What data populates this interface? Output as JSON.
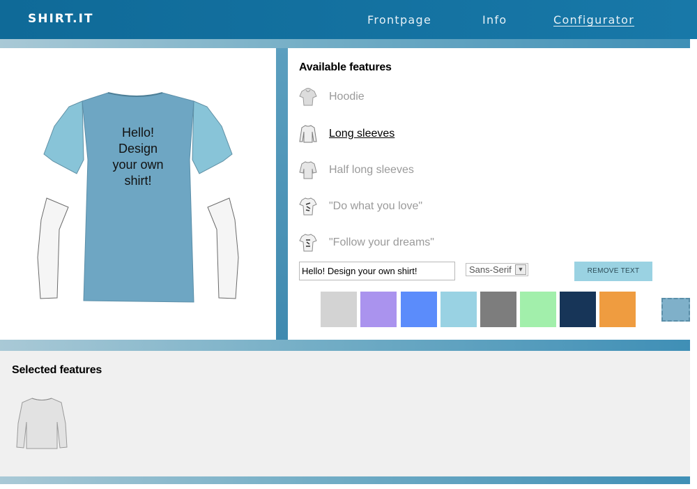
{
  "nav": {
    "logo": "SHIRT.IT",
    "links": [
      "Frontpage",
      "Info",
      "Configurator"
    ]
  },
  "preview": {
    "shirt_text": "Hello!\nDesign\nyour own\nshirt!"
  },
  "features": {
    "title": "Available features",
    "items": [
      {
        "label": "Hoodie",
        "icon": "hoodie-icon"
      },
      {
        "label": "Long sleeves",
        "icon": "long-sleeve-shirt-icon"
      },
      {
        "label": "Half long sleeves",
        "icon": "half-sleeve-shirt-icon"
      },
      {
        "label": "\"Do what you love\"",
        "icon": "print-shirt-icon"
      },
      {
        "label": "\"Follow your dreams\"",
        "icon": "print-shirt-icon"
      }
    ],
    "active_item": "Long sleeves"
  },
  "editor": {
    "text_value": "Hello! Design your own shirt!",
    "font_value": "Sans-Serif",
    "remove_label": "REMOVE TEXT"
  },
  "colors": {
    "swatches": [
      "#d3d3d3",
      "#aa93ee",
      "#5b8cfb",
      "#99d2e3",
      "#7d7d7d",
      "#a2efab",
      "#173558",
      "#ef9c40"
    ],
    "picker": "#7fb0c9",
    "shirt_body": "#6ea6c3",
    "shirt_sleeve_cap": "#88c4d8",
    "nav_bg": "#1475a6"
  },
  "selected": {
    "title": "Selected features",
    "items": [
      {
        "icon": "long-sleeve-shirt-icon"
      }
    ]
  }
}
